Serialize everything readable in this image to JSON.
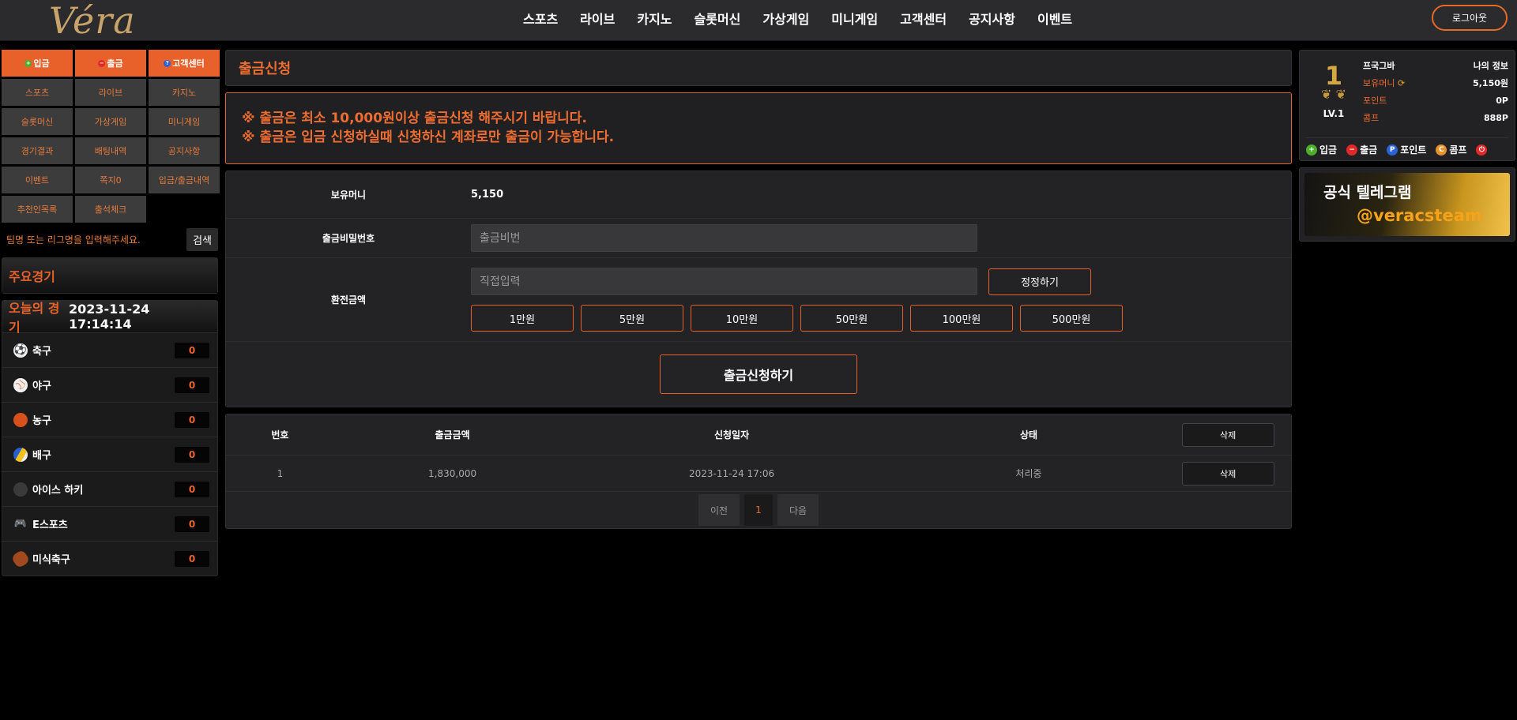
{
  "header": {
    "logo": "Véra",
    "nav": [
      "스포츠",
      "라이브",
      "카지노",
      "슬롯머신",
      "가상게임",
      "미니게임",
      "고객센터",
      "공지사항",
      "이벤트"
    ],
    "logout": "로그아웃"
  },
  "sidebar": {
    "top_buttons": [
      "입금",
      "출금",
      "고객센터"
    ],
    "menu": [
      "스포츠",
      "라이브",
      "카지노",
      "슬롯머신",
      "가상게임",
      "미니게임",
      "경기결과",
      "배팅내역",
      "공지사항",
      "이벤트",
      "쪽지0",
      "입금/출금내역",
      "추천인목록",
      "출석체크"
    ],
    "search_placeholder": "팀명 또는 리그명을 입력해주세요.",
    "search_button": "검색",
    "featured_title": "주요경기",
    "today_title": "오늘의 경기",
    "today_time": "2023-11-24 17:14:14",
    "sports": [
      {
        "name": "축구",
        "count": "0",
        "icon": "soccer-ball-icon"
      },
      {
        "name": "야구",
        "count": "0",
        "icon": "baseball-icon"
      },
      {
        "name": "농구",
        "count": "0",
        "icon": "basketball-icon"
      },
      {
        "name": "배구",
        "count": "0",
        "icon": "volleyball-icon"
      },
      {
        "name": "아이스 하키",
        "count": "0",
        "icon": "hockey-puck-icon"
      },
      {
        "name": "E스포츠",
        "count": "0",
        "icon": "gamepad-icon"
      },
      {
        "name": "미식축구",
        "count": "0",
        "icon": "football-icon"
      }
    ]
  },
  "main": {
    "title": "출금신청",
    "notices": [
      "※ 출금은 최소 10,000원이상 출금신청 해주시기 바랍니다.",
      "※ 출금은 입금 신청하실때 신청하신 계좌로만 출금이 가능합니다."
    ],
    "form": {
      "money_label": "보유머니",
      "money_value": "5,150",
      "password_label": "출금비밀번호",
      "password_placeholder": "출금비번",
      "amount_label": "환전금액",
      "amount_placeholder": "직접입력",
      "reset_button": "정정하기",
      "amount_buttons": [
        "1만원",
        "5만원",
        "10만원",
        "50만원",
        "100만원",
        "500만원"
      ],
      "submit": "출금신청하기"
    },
    "table": {
      "headers": [
        "번호",
        "출금금액",
        "신청일자",
        "상태",
        "삭제"
      ],
      "rows": [
        {
          "no": "1",
          "amount": "1,830,000",
          "date": "2023-11-24 17:06",
          "status": "처리중",
          "action": "삭제"
        }
      ]
    },
    "pager": {
      "prev": "이전",
      "current": "1",
      "next": "다음"
    }
  },
  "user": {
    "rank": "1",
    "level": "LV.1",
    "name": "프국그바",
    "my_info": "나의 정보",
    "money_label": "보유머니",
    "money_value": "5,150원",
    "point_label": "포인트",
    "point_value": "0P",
    "comp_label": "콤프",
    "comp_value": "888P",
    "actions": [
      "입금",
      "출금",
      "포인트",
      "콤프"
    ]
  },
  "banner": {
    "line1": "공식 텔레그램",
    "line2": "@veracsteam"
  },
  "colors": {
    "accent": "#e8612a",
    "background": "#000000",
    "panel": "#232325"
  }
}
